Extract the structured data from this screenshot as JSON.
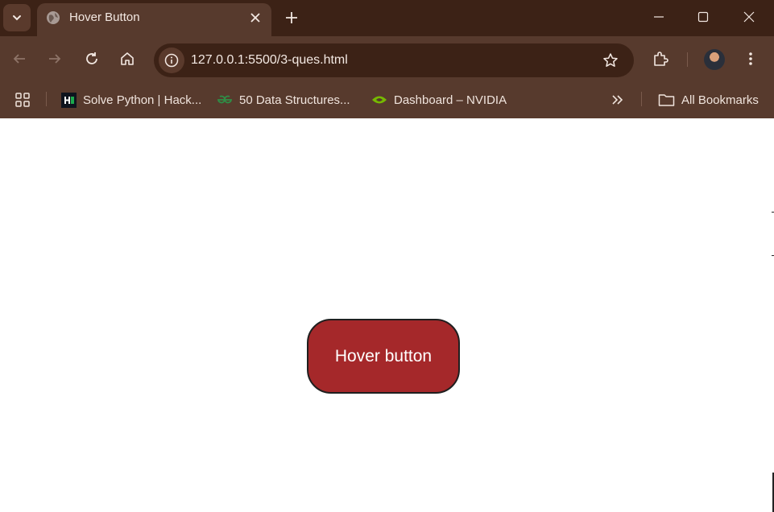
{
  "browser": {
    "tab": {
      "title": "Hover Button"
    },
    "address_bar": {
      "url": "127.0.0.1:5500/3-ques.html"
    },
    "bookmarks": [
      {
        "label": "Solve Python | Hack...",
        "icon": "hackerrank-icon"
      },
      {
        "label": "50 Data Structures...",
        "icon": "geeksforgeeks-icon"
      },
      {
        "label": "Dashboard – NVIDIA",
        "icon": "nvidia-icon"
      }
    ],
    "all_bookmarks_label": "All Bookmarks"
  },
  "page": {
    "button_label": "Hover button"
  },
  "colors": {
    "tabbar_bg": "#3c2216",
    "toolbar_bg": "#573a2d",
    "button_bg": "#a5282a",
    "button_border": "#1f1f1f"
  }
}
